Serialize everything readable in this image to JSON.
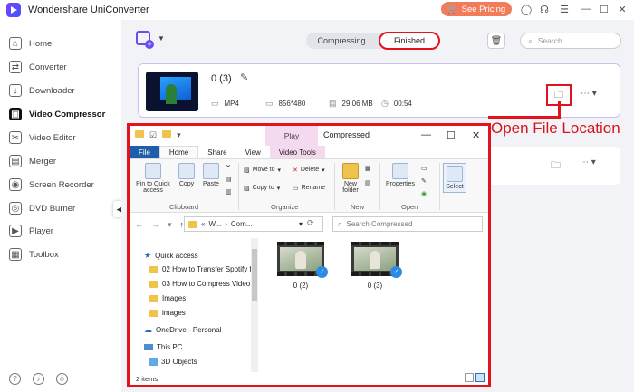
{
  "app": {
    "title": "Wondershare UniConverter",
    "pricing_label": "See Pricing"
  },
  "sidebar": {
    "items": [
      {
        "label": "Home",
        "icon": "home-icon",
        "glyph": "⌂"
      },
      {
        "label": "Converter",
        "icon": "converter-icon",
        "glyph": "⇄"
      },
      {
        "label": "Downloader",
        "icon": "downloader-icon",
        "glyph": "↓"
      },
      {
        "label": "Video Compressor",
        "icon": "compressor-icon",
        "glyph": "▣",
        "active": true
      },
      {
        "label": "Video Editor",
        "icon": "scissors-icon",
        "glyph": "✂"
      },
      {
        "label": "Merger",
        "icon": "merger-icon",
        "glyph": "▤"
      },
      {
        "label": "Screen Recorder",
        "icon": "recorder-icon",
        "glyph": "◉"
      },
      {
        "label": "DVD Burner",
        "icon": "dvd-icon",
        "glyph": "◎"
      },
      {
        "label": "Player",
        "icon": "player-icon",
        "glyph": "▶"
      },
      {
        "label": "Toolbox",
        "icon": "toolbox-icon",
        "glyph": "▦"
      }
    ]
  },
  "main": {
    "tabs": {
      "compressing": "Compressing",
      "finished": "Finished"
    },
    "search_placeholder": "Search",
    "file": {
      "name": "0 (3)",
      "format": "MP4",
      "resolution": "856*480",
      "size": "29.06 MB",
      "duration": "00:54"
    }
  },
  "callout": {
    "label": "Open File Location",
    "color": "#e3121b"
  },
  "explorer": {
    "title": "Compressed",
    "play_label": "Play",
    "tabs": {
      "file": "File",
      "home": "Home",
      "share": "Share",
      "view": "View",
      "video_tools": "Video Tools"
    },
    "ribbon": {
      "pin": "Pin to Quick access",
      "copy": "Copy",
      "paste": "Paste",
      "move_to": "Move to",
      "delete": "Delete",
      "copy_to": "Copy to",
      "rename": "Rename",
      "new_folder": "New folder",
      "properties": "Properties",
      "select": "Select",
      "groups": {
        "clipboard": "Clipboard",
        "organize": "Organize",
        "new": "New",
        "open": "Open"
      }
    },
    "address": {
      "prefix": "«",
      "part1": "W...",
      "part2": "Com..."
    },
    "search_placeholder": "Search Compressed",
    "tree": {
      "quick_access": "Quick access",
      "folders": [
        "02 How to Transfer Spotify fr",
        "03 How to Compress Video F",
        "Images",
        "images"
      ],
      "onedrive": "OneDrive - Personal",
      "this_pc": "This PC",
      "objects": "3D Objects"
    },
    "files": [
      "0 (2)",
      "0 (3)"
    ],
    "status": "2 items"
  }
}
